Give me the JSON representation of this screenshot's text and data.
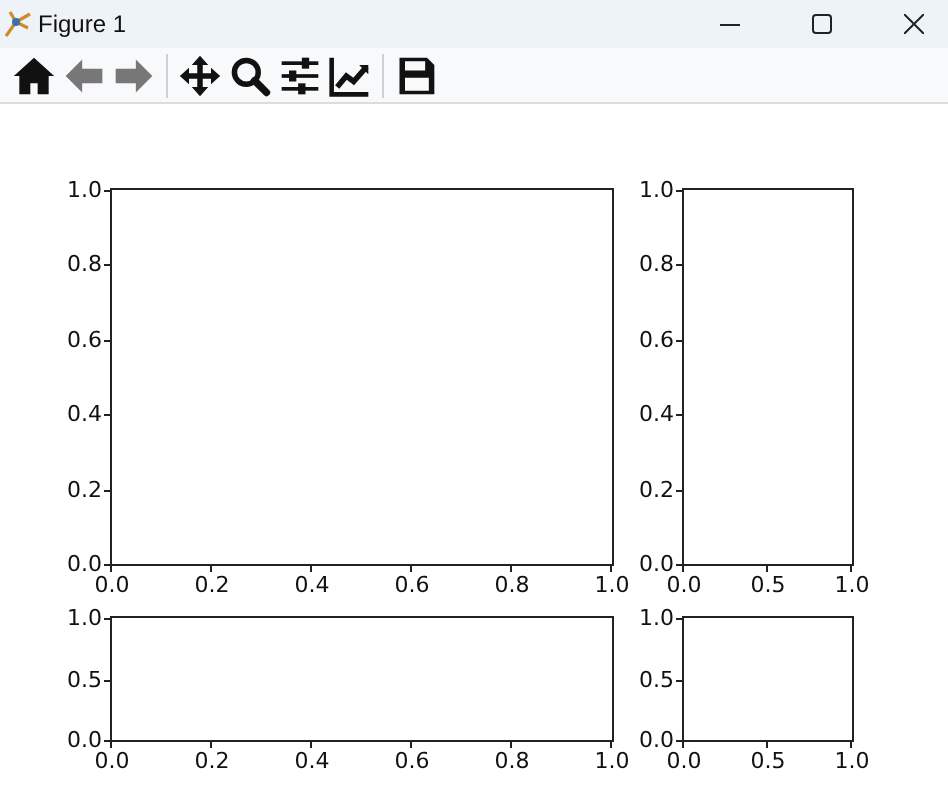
{
  "window": {
    "title": "Figure 1"
  },
  "toolbar": [
    {
      "kind": "home",
      "disabled": false
    },
    {
      "kind": "back",
      "disabled": true
    },
    {
      "kind": "forward",
      "disabled": true
    },
    {
      "kind": "separator"
    },
    {
      "kind": "pan",
      "disabled": false
    },
    {
      "kind": "zoom",
      "disabled": false
    },
    {
      "kind": "subplots",
      "disabled": false
    },
    {
      "kind": "edit",
      "disabled": false
    },
    {
      "kind": "separator"
    },
    {
      "kind": "save",
      "disabled": false
    }
  ],
  "axes": [
    {
      "xticks": [
        "0.0",
        "0.2",
        "0.4",
        "0.6",
        "0.8",
        "1.0"
      ],
      "yticks": [
        "1.0",
        "0.8",
        "0.6",
        "0.4",
        "0.2",
        "0.0"
      ]
    },
    {
      "xticks": [
        "0.0",
        "0.5",
        "1.0"
      ],
      "yticks": [
        "1.0",
        "0.8",
        "0.6",
        "0.4",
        "0.2",
        "0.0"
      ]
    },
    {
      "xticks": [
        "0.0",
        "0.2",
        "0.4",
        "0.6",
        "0.8",
        "1.0"
      ],
      "yticks": [
        "1.0",
        "0.5",
        "0.0"
      ]
    },
    {
      "xticks": [
        "0.0",
        "0.5",
        "1.0"
      ],
      "yticks": [
        "1.0",
        "0.5",
        "0.0"
      ]
    }
  ]
}
